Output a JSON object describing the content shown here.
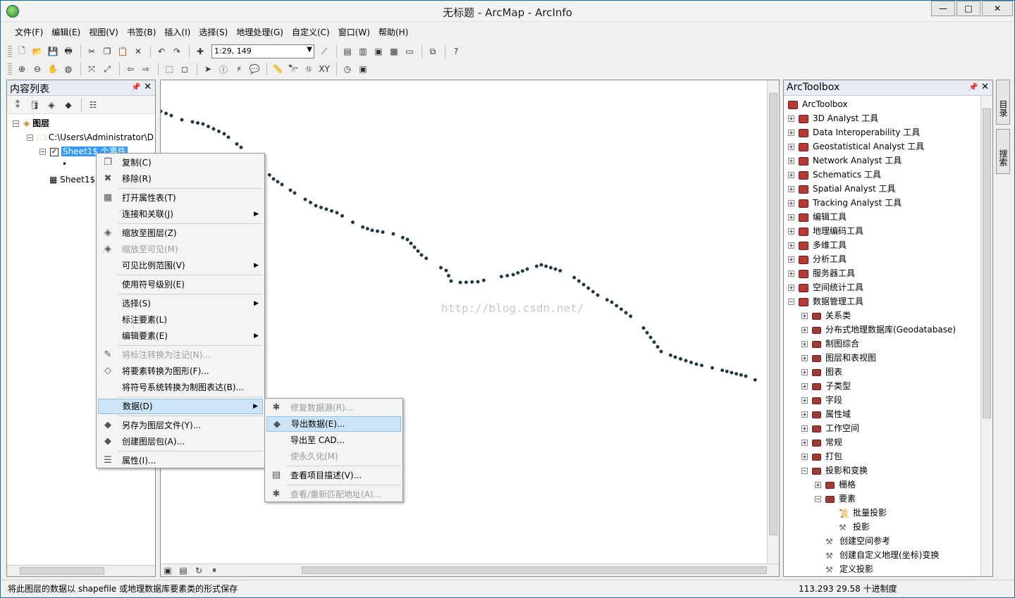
{
  "window": {
    "title": "无标题 - ArcMap - ArcInfo",
    "min": "—",
    "max": "□",
    "close": "✕"
  },
  "menubar": [
    "文件(F)",
    "编辑(E)",
    "视图(V)",
    "书签(B)",
    "插入(I)",
    "选择(S)",
    "地理处理(G)",
    "自定义(C)",
    "窗口(W)",
    "帮助(H)"
  ],
  "toolbar": {
    "scale": "1:29, 149"
  },
  "toc": {
    "title": "内容列表",
    "layers_label": "图层",
    "path_label": "C:\\Users\\Administrator\\D",
    "layer_name": "Sheet1$ 个事件",
    "table_name": "Sheet1$"
  },
  "context_menu": [
    {
      "label": "复制(C)",
      "icon": "copy-icon",
      "glyph": "❐",
      "disabled": false
    },
    {
      "label": "移除(R)",
      "icon": "remove-icon",
      "glyph": "✖",
      "disabled": false
    },
    {
      "label": "打开属性表(T)",
      "icon": "table-icon",
      "glyph": "▦",
      "disabled": false
    },
    {
      "label": "连接和关联(J)",
      "icon": "",
      "glyph": "",
      "disabled": false,
      "submenu": true
    },
    {
      "label": "缩放至图层(Z)",
      "icon": "zoom-layer-icon",
      "glyph": "◈",
      "disabled": false
    },
    {
      "label": "缩放至可见(M)",
      "icon": "zoom-visible-icon",
      "glyph": "◈",
      "disabled": true
    },
    {
      "label": "可见比例范围(V)",
      "icon": "",
      "glyph": "",
      "disabled": false,
      "submenu": true
    },
    {
      "label": "使用符号级别(E)",
      "icon": "",
      "glyph": "",
      "disabled": false
    },
    {
      "label": "选择(S)",
      "icon": "",
      "glyph": "",
      "disabled": false,
      "submenu": true
    },
    {
      "label": "标注要素(L)",
      "icon": "",
      "glyph": "",
      "disabled": false
    },
    {
      "label": "编辑要素(E)",
      "icon": "",
      "glyph": "",
      "disabled": false,
      "submenu": true
    },
    {
      "label": "将标注转换为注记(N)...",
      "icon": "annotation-icon",
      "glyph": "✎",
      "disabled": true
    },
    {
      "label": "将要素转换为图形(F)...",
      "icon": "graphics-icon",
      "glyph": "◇",
      "disabled": false
    },
    {
      "label": "将符号系统转换为制图表达(B)...",
      "icon": "",
      "glyph": "",
      "disabled": false
    },
    {
      "label": "数据(D)",
      "icon": "",
      "glyph": "",
      "disabled": false,
      "submenu": true,
      "highlight": true
    },
    {
      "label": "另存为图层文件(Y)...",
      "icon": "layer-file-icon",
      "glyph": "◆",
      "disabled": false
    },
    {
      "label": "创建图层包(A)...",
      "icon": "package-icon",
      "glyph": "◆",
      "disabled": false
    },
    {
      "label": "属性(I)...",
      "icon": "properties-icon",
      "glyph": "☰",
      "disabled": false
    }
  ],
  "submenu": [
    {
      "label": "修复数据源(R)...",
      "icon": "repair-icon",
      "glyph": "✱",
      "disabled": true
    },
    {
      "label": "导出数据(E)...",
      "icon": "export-icon",
      "glyph": "◆",
      "disabled": false,
      "highlight": true
    },
    {
      "label": "导出至 CAD...",
      "icon": "",
      "glyph": "",
      "disabled": false
    },
    {
      "label": "使永久化(M)",
      "icon": "",
      "glyph": "",
      "disabled": true
    },
    {
      "label": "查看项目描述(V)...",
      "icon": "description-icon",
      "glyph": "▤",
      "disabled": false
    },
    {
      "label": "查看/重新匹配地址(A)...",
      "icon": "geocode-icon",
      "glyph": "✱",
      "disabled": true
    }
  ],
  "map": {
    "watermark": "http://blog.csdn.net/"
  },
  "toolbox": {
    "title": "ArcToolbox",
    "root": "ArcToolbox",
    "items": [
      {
        "label": "3D Analyst 工具",
        "level": 1,
        "type": "box"
      },
      {
        "label": "Data Interoperability 工具",
        "level": 1,
        "type": "box"
      },
      {
        "label": "Geostatistical Analyst 工具",
        "level": 1,
        "type": "box"
      },
      {
        "label": "Network Analyst 工具",
        "level": 1,
        "type": "box"
      },
      {
        "label": "Schematics 工具",
        "level": 1,
        "type": "box"
      },
      {
        "label": "Spatial Analyst 工具",
        "level": 1,
        "type": "box"
      },
      {
        "label": "Tracking Analyst 工具",
        "level": 1,
        "type": "box"
      },
      {
        "label": "编辑工具",
        "level": 1,
        "type": "box"
      },
      {
        "label": "地理编码工具",
        "level": 1,
        "type": "box"
      },
      {
        "label": "多维工具",
        "level": 1,
        "type": "box"
      },
      {
        "label": "分析工具",
        "level": 1,
        "type": "box"
      },
      {
        "label": "服务器工具",
        "level": 1,
        "type": "box"
      },
      {
        "label": "空间统计工具",
        "level": 1,
        "type": "box"
      },
      {
        "label": "数据管理工具",
        "level": 1,
        "type": "box",
        "expanded": true
      },
      {
        "label": "关系类",
        "level": 2,
        "type": "set"
      },
      {
        "label": "分布式地理数据库(Geodatabase)",
        "level": 2,
        "type": "set"
      },
      {
        "label": "制图综合",
        "level": 2,
        "type": "set"
      },
      {
        "label": "图层和表视图",
        "level": 2,
        "type": "set"
      },
      {
        "label": "图表",
        "level": 2,
        "type": "set"
      },
      {
        "label": "子类型",
        "level": 2,
        "type": "set"
      },
      {
        "label": "字段",
        "level": 2,
        "type": "set"
      },
      {
        "label": "属性域",
        "level": 2,
        "type": "set"
      },
      {
        "label": "工作空间",
        "level": 2,
        "type": "set"
      },
      {
        "label": "常规",
        "level": 2,
        "type": "set"
      },
      {
        "label": "打包",
        "level": 2,
        "type": "set"
      },
      {
        "label": "投影和变换",
        "level": 2,
        "type": "set",
        "expanded": true
      },
      {
        "label": "栅格",
        "level": 3,
        "type": "set"
      },
      {
        "label": "要素",
        "level": 3,
        "type": "set",
        "expanded": true
      },
      {
        "label": "批量投影",
        "level": 4,
        "type": "script"
      },
      {
        "label": "投影",
        "level": 4,
        "type": "tool"
      },
      {
        "label": "创建空间参考",
        "level": 3,
        "type": "tool"
      },
      {
        "label": "创建自定义地理(坐标)变换",
        "level": 3,
        "type": "tool"
      },
      {
        "label": "定义投影",
        "level": 3,
        "type": "tool"
      }
    ]
  },
  "side_tabs": [
    "目录",
    "搜索"
  ],
  "status": {
    "message": "将此图层的数据以 shapefile 或地理数据库要素类的形式保存",
    "coords": "113.293  29.58 十进制度"
  }
}
